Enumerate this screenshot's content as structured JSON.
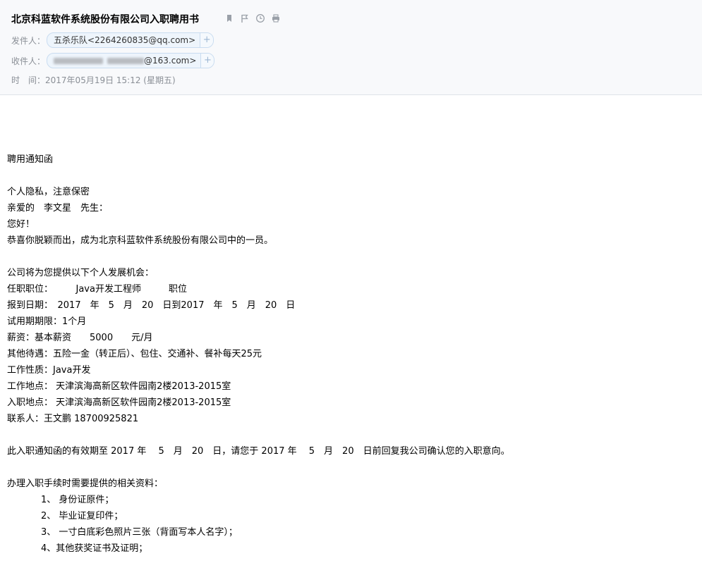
{
  "email": {
    "subject": "北京科蓝软件系统股份有限公司入职聘用书",
    "from_label": "发件人：",
    "from_value": "五杀乐队<2264260835@qq.com>",
    "to_label": "收件人：",
    "to_value_tail": "@163.com>",
    "time_label": "时　间：",
    "time_value": "2017年05月19日 15:12 (星期五)",
    "chip_add": "+"
  },
  "body": {
    "l1": "聘用通知函",
    "l2": "个人隐私，注意保密",
    "l3": "亲爱的　李文星　先生：",
    "l4": "您好！",
    "l5": "恭喜你脱颖而出，成为北京科蓝软件系统股份有限公司中的一员。",
    "l6": "公司将为您提供以下个人发展机会：",
    "l7": "任职职位：　　　Java开发工程师　　　职位",
    "l8": "报到日期：　2017　年　5　月　20　日到2017　年　5　月　20　日",
    "l9": "试用期期限：1个月",
    "l10": "薪资：基本薪资　　5000　　元/月",
    "l11": "其他待遇：五险一金（转正后）、包住、交通补、餐补每天25元",
    "l12": "工作性质：Java开发",
    "l13": "工作地点： 天津滨海高新区软件园南2楼2013-2015室",
    "l14": "入职地点： 天津滨海高新区软件园南2楼2013-2015室",
    "l15": "联系人：王文鹏 18700925821",
    "l16": "此入职通知函的有效期至 2017 年　 5　月　20　日，请您于 2017 年　 5　月　20　日前回复我公司确认您的入职意向。",
    "l17": "办理入职手续时需要提供的相关资料：",
    "items": [
      "1、 身份证原件；",
      "2、 毕业证复印件；",
      "3、 一寸白底彩色照片三张（背面写本人名字）；",
      "4、其他获奖证书及证明；"
    ]
  }
}
